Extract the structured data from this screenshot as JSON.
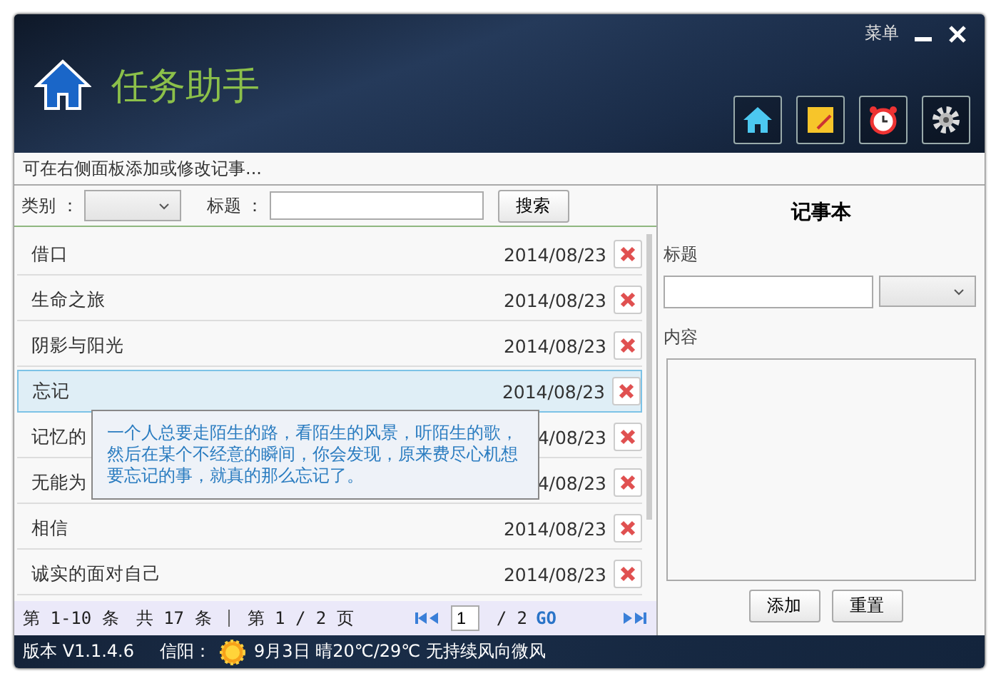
{
  "window": {
    "menu_label": "菜单"
  },
  "app": {
    "title": "任务助手"
  },
  "hint": "可在右侧面板添加或修改记事...",
  "filter": {
    "category_label": "类别 ：",
    "title_label": "标题 ：",
    "search_button": "搜索"
  },
  "rows": [
    {
      "title": "借口",
      "date": "2014/08/23",
      "selected": false
    },
    {
      "title": "生命之旅",
      "date": "2014/08/23",
      "selected": false
    },
    {
      "title": "阴影与阳光",
      "date": "2014/08/23",
      "selected": false
    },
    {
      "title": "忘记",
      "date": "2014/08/23",
      "selected": true
    },
    {
      "title": "记忆的",
      "date": "4/08/23",
      "selected": false
    },
    {
      "title": "无能为",
      "date": "4/08/23",
      "selected": false
    },
    {
      "title": "相信",
      "date": "2014/08/23",
      "selected": false
    },
    {
      "title": "诚实的面对自己",
      "date": "2014/08/23",
      "selected": false
    }
  ],
  "tooltip": "一个人总要走陌生的路，看陌生的风景，听陌生的歌，然后在某个不经意的瞬间，你会发现，原来费尽心机想要忘记的事，就真的那么忘记了。",
  "pagination": {
    "range": "第 1-10 条",
    "total": "共 17 条",
    "page": "第 1 / 2 页",
    "page_input": "1",
    "page_total": "/ 2",
    "go": "GO"
  },
  "notepad": {
    "title": "记事本",
    "title_label": "标题",
    "content_label": "内容",
    "buttons": [
      "添加",
      "重置"
    ]
  },
  "status_bar": {
    "version": "版本 V1.1.4.6",
    "city": "信阳：",
    "weather": "9月3日 晴20℃/29℃ 无持续风向微风"
  }
}
